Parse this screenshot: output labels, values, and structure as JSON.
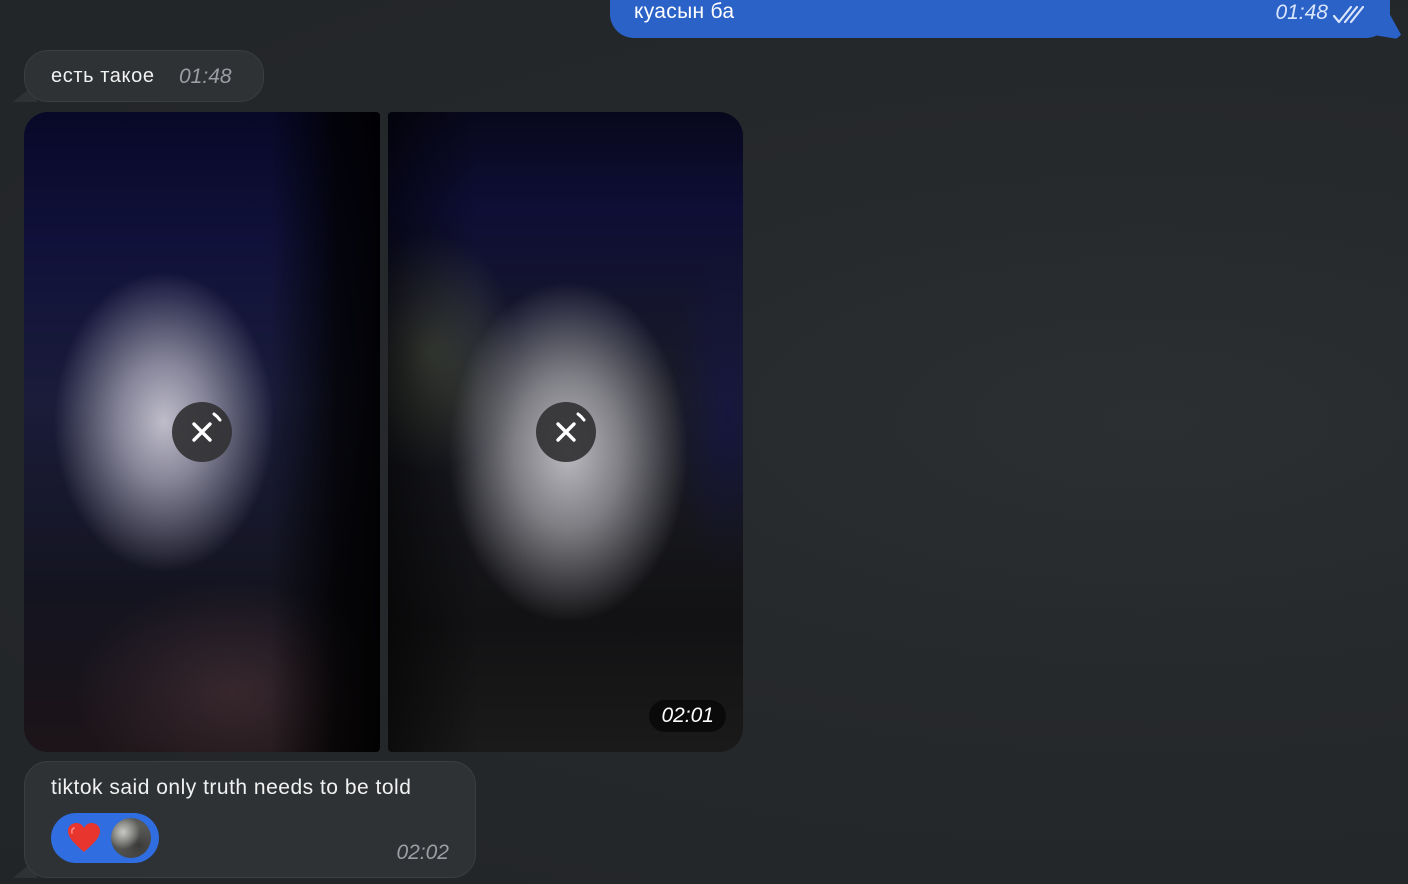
{
  "messages": {
    "outgoing_top": {
      "text": "куасын ба",
      "time": "01:48"
    },
    "incoming_1": {
      "text": "есть такое",
      "time": "01:48"
    },
    "album": {
      "time": "02:01"
    },
    "incoming_2": {
      "text": "tiktok said only truth needs to be told",
      "time": "02:02",
      "reaction": {
        "emoji": "♥"
      }
    }
  },
  "colors": {
    "background": "#24272a",
    "incoming_bubble": "#2f3235",
    "outgoing_bubble": "#2b62c8",
    "reaction_pill": "#2f6de1",
    "heart": "#e8352e"
  }
}
